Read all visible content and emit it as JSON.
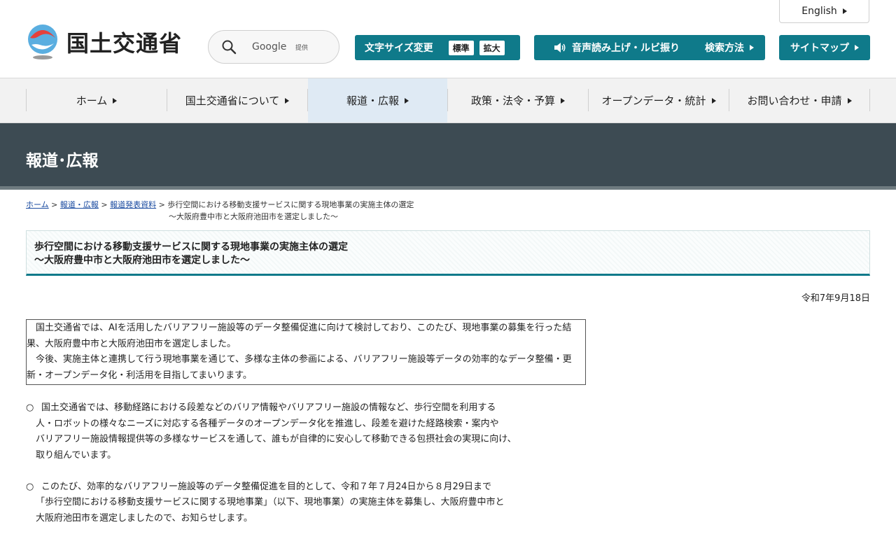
{
  "header": {
    "logo_text": "国土交通省",
    "search_brand": "Google",
    "search_provider": "提供",
    "english_label": "English",
    "font_size_label": "文字サイズ変更",
    "font_size_standard": "標準",
    "font_size_large": "拡大",
    "voice_label": "音声読み上げ・ルビ振り",
    "search_method_label": "検索方法",
    "sitemap_label": "サイトマップ"
  },
  "nav": {
    "items": [
      {
        "label": "ホーム"
      },
      {
        "label": "国土交通省について"
      },
      {
        "label": "報道・広報"
      },
      {
        "label": "政策・法令・予算"
      },
      {
        "label": "オープンデータ・統計"
      },
      {
        "label": "お問い合わせ・申請"
      }
    ]
  },
  "banner": {
    "title": "報道･広報"
  },
  "breadcrumb": {
    "home": "ホーム",
    "sep": ">",
    "press": "報道・広報",
    "releases": "報道発表資料",
    "current_line1": "歩行空間における移動支援サービスに関する現地事業の実施主体の選定",
    "current_line2": "～大阪府豊中市と大阪府池田市を選定しました～"
  },
  "article": {
    "title_line1": "歩行空間における移動支援サービスに関する現地事業の実施主体の選定",
    "title_line2": "～大阪府豊中市と大阪府池田市を選定しました～",
    "date": "令和7年9月18日",
    "summary_p1": "　国土交通省では、AIを活用したバリアフリー施設等のデータ整備促進に向けて検討しており、このたび、現地事業の募集を行った結果、大阪府豊中市と大阪府池田市を選定しました。",
    "summary_p2": "　今後、実施主体と連携して行う現地事業を通じて、多様な主体の参画による、バリアフリー施設等データの効率的なデータ整備・更新・オープンデータ化・利活用を目指してまいります。",
    "bullet_mark": "○",
    "bullet1": [
      "国土交通省では、移動経路における段差などのバリア情報やバリアフリー施設の情報など、歩行空間を利用する",
      "人・ロボットの様々なニーズに対応する各種データのオープンデータ化を推進し、段差を避けた経路検索・案内や",
      "バリアフリー施設情報提供等の多様なサービスを通して、誰もが自律的に安心して移動できる包摂社会の実現に向け、",
      "取り組んでいます。"
    ],
    "bullet2": [
      "このたび、効率的なバリアフリー施設等のデータ整備促進を目的として、令和７年７月24日から８月29日まで",
      "「歩行空間における移動支援サービスに関する現地事業」（以下、現地事業）の実施主体を募集し、大阪府豊中市と",
      "大阪府池田市を選定しましたので、お知らせします。"
    ]
  },
  "colors": {
    "accent": "#0f7a8a",
    "banner": "#3d4b53",
    "nav_active": "#dfeaf4"
  }
}
